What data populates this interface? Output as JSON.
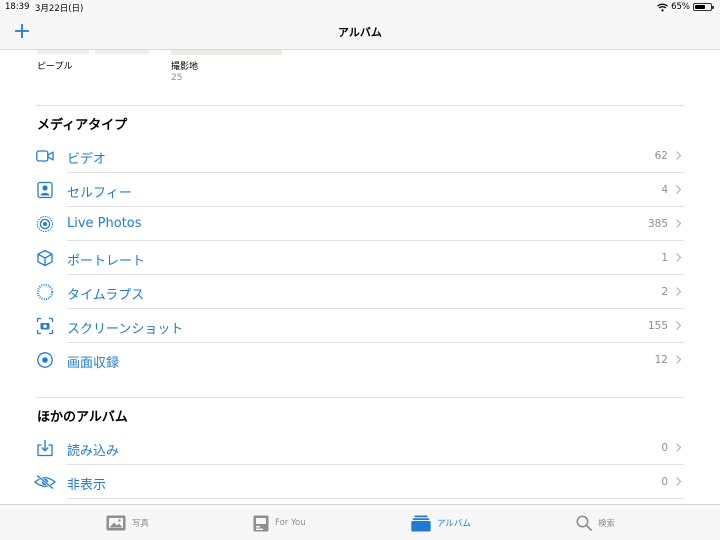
{
  "status_bar": {
    "time": "18:39",
    "date": "3月22日(日)",
    "battery": "65%",
    "battery_level": 0.65
  },
  "nav": {
    "title": "アルバム",
    "add_icon": "plus-icon"
  },
  "albums_row": [
    {
      "label": "ピープル",
      "count": ""
    },
    {
      "label": "撮影地",
      "count": "25"
    }
  ],
  "media_types": {
    "title": "メディアタイプ",
    "items": [
      {
        "label": "ビデオ",
        "count": "62",
        "icon": "video-camera-icon"
      },
      {
        "label": "セルフィー",
        "count": "4",
        "icon": "selfie-portrait-icon"
      },
      {
        "label": "Live Photos",
        "count": "385",
        "icon": "live-photos-icon"
      },
      {
        "label": "ポートレート",
        "count": "1",
        "icon": "cube-icon"
      },
      {
        "label": "タイムラプス",
        "count": "2",
        "icon": "timelapse-icon"
      },
      {
        "label": "スクリーンショット",
        "count": "155",
        "icon": "screenshot-icon"
      },
      {
        "label": "画面収録",
        "count": "12",
        "icon": "screen-recording-icon"
      }
    ]
  },
  "other_albums": {
    "title": "ほかのアルバム",
    "items": [
      {
        "label": "読み込み",
        "count": "0",
        "icon": "import-icon"
      },
      {
        "label": "非表示",
        "count": "0",
        "icon": "hidden-eye-icon"
      }
    ]
  },
  "tab_bar": {
    "tabs": [
      {
        "label": "写真",
        "icon": "photos-icon"
      },
      {
        "label": "For You",
        "icon": "for-you-icon"
      },
      {
        "label": "アルバム",
        "icon": "albums-icon"
      },
      {
        "label": "検索",
        "icon": "search-icon"
      }
    ],
    "active": "アルバム"
  },
  "colors": {
    "accent": "#1f7bd8",
    "secondary_text": "#8e8e93",
    "bar_background": "#f7f7f7"
  }
}
